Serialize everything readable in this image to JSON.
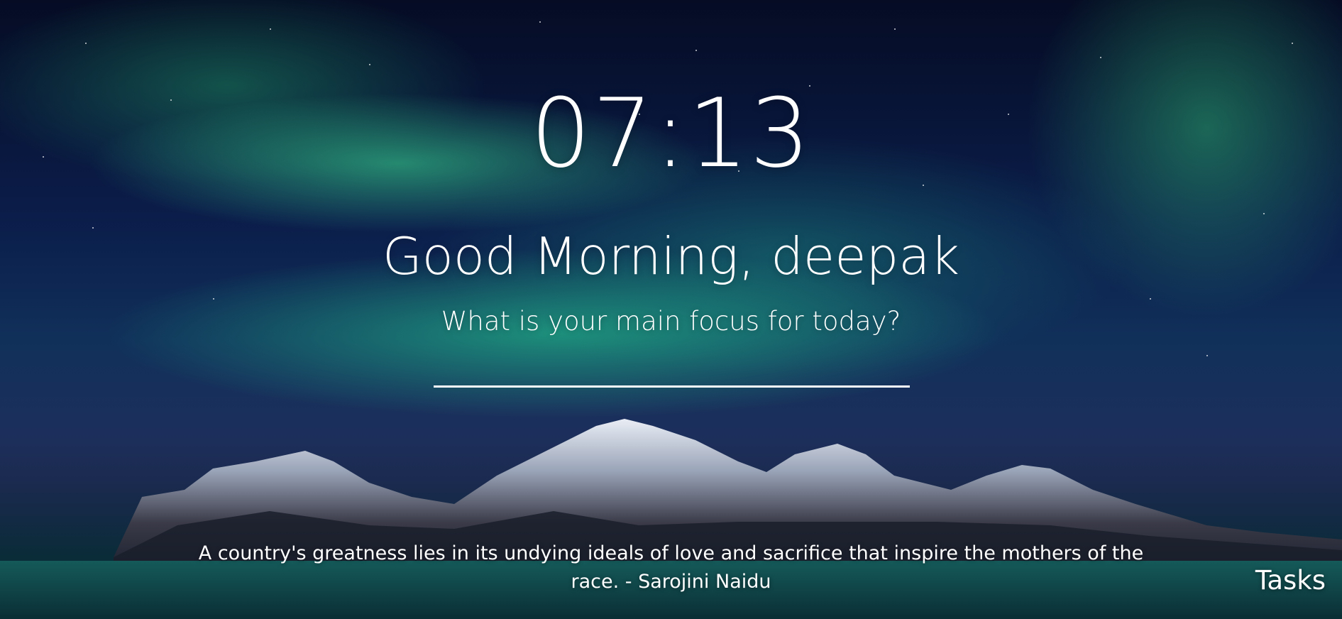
{
  "clock": {
    "time": "07:13"
  },
  "greeting": {
    "text": "Good Morning, deepak"
  },
  "focus": {
    "prompt": "What is your main focus for today?",
    "value": ""
  },
  "quote": {
    "text": "A country's greatness lies in its undying ideals of love and sacrifice that inspire the mothers of the race. - Sarojini Naidu"
  },
  "tasks": {
    "label": "Tasks"
  },
  "background": {
    "description_colors": {
      "sky": "#0b1d4a",
      "aurora": "#3ce696",
      "water": "#0b3a3e"
    }
  }
}
